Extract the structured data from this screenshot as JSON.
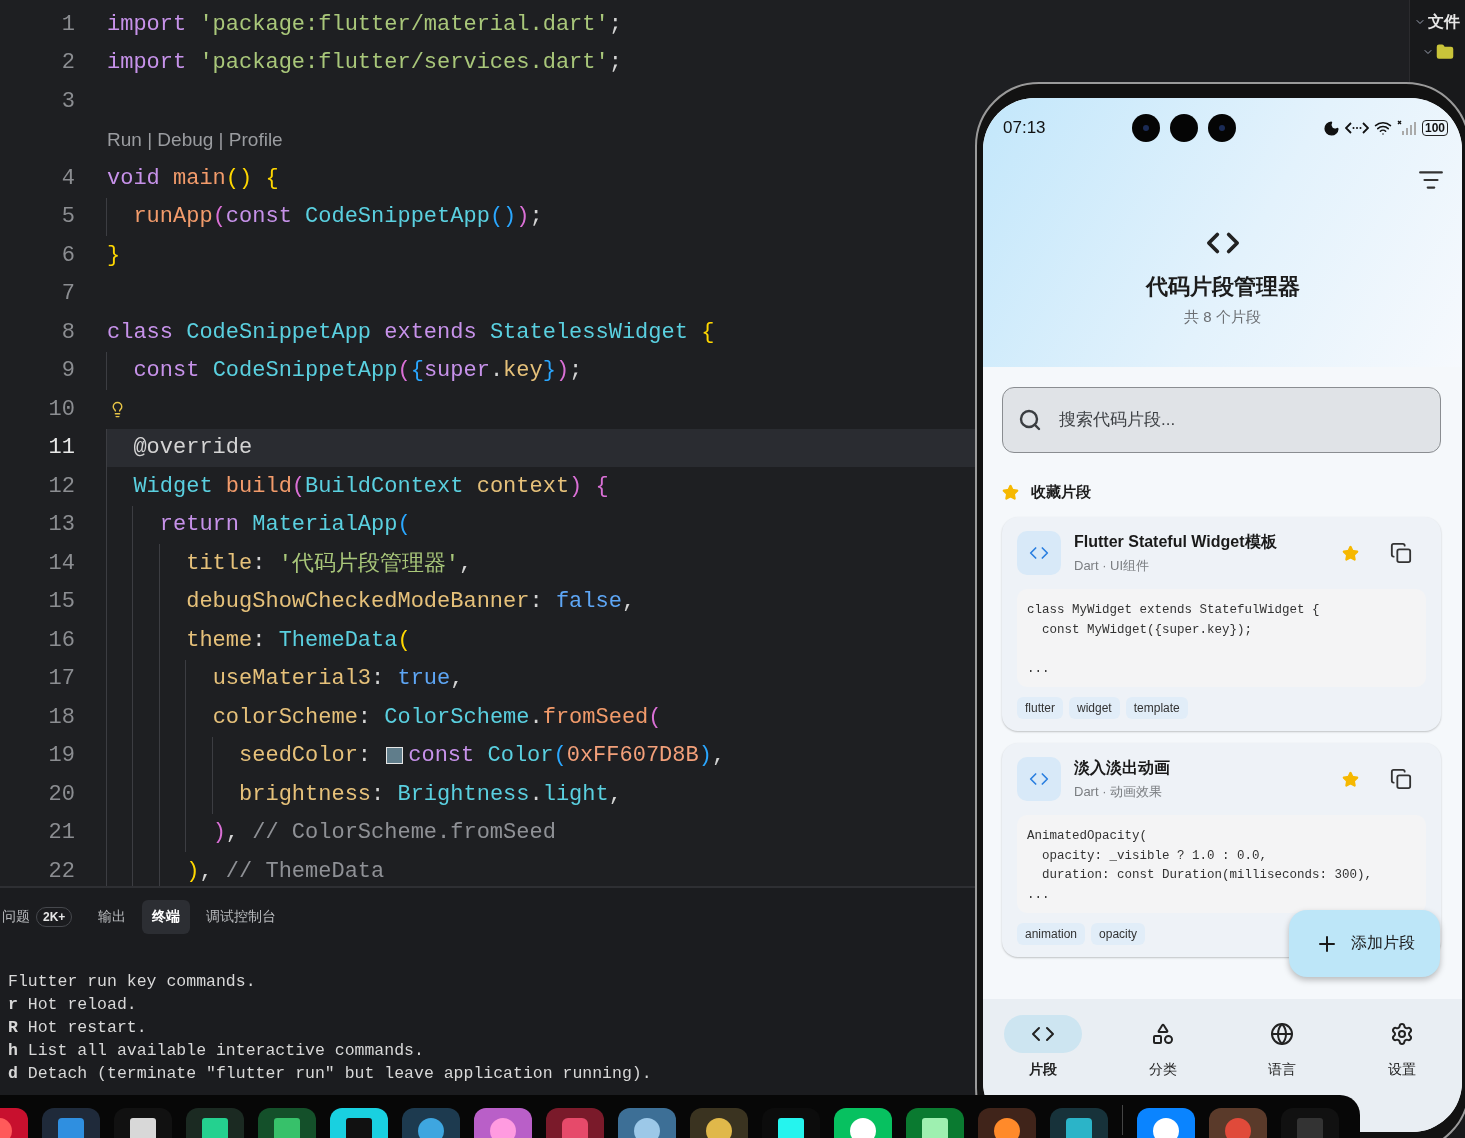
{
  "editor": {
    "lines": [
      {
        "kind": "code",
        "number": "1",
        "current": false,
        "lightbulb": false,
        "tokens": [
          {
            "kind": "kw",
            "text": "import "
          },
          {
            "kind": "str",
            "text": "'package:flutter/material.dart'"
          },
          {
            "kind": "p",
            "text": ";"
          }
        ]
      },
      {
        "kind": "code",
        "number": "2",
        "current": false,
        "lightbulb": false,
        "tokens": [
          {
            "kind": "kw",
            "text": "import "
          },
          {
            "kind": "str",
            "text": "'package:flutter/services.dart'"
          },
          {
            "kind": "p",
            "text": ";"
          }
        ]
      },
      {
        "kind": "code",
        "number": "3",
        "current": false,
        "lightbulb": false
      },
      {
        "kind": "codelens",
        "text": "Run | Debug | Profile"
      },
      {
        "kind": "code",
        "number": "4",
        "current": false,
        "lightbulb": false,
        "tokens": [
          {
            "kind": "kw",
            "text": "void "
          },
          {
            "kind": "fn",
            "text": "main"
          },
          {
            "kind": "b1",
            "text": "() {"
          }
        ]
      },
      {
        "kind": "code",
        "number": "5",
        "current": false,
        "lightbulb": false,
        "tokens": [
          {
            "kind": "fn",
            "text": "  runApp"
          },
          {
            "kind": "b2",
            "text": "("
          },
          {
            "kind": "kw",
            "text": "const "
          },
          {
            "kind": "type",
            "text": "CodeSnippetApp"
          },
          {
            "kind": "b3",
            "text": "()"
          },
          {
            "kind": "b2",
            "text": ")"
          },
          {
            "kind": "p",
            "text": ";"
          }
        ]
      },
      {
        "kind": "code",
        "number": "6",
        "current": false,
        "lightbulb": false,
        "tokens": [
          {
            "kind": "b1",
            "text": "}"
          }
        ]
      },
      {
        "kind": "code",
        "number": "7",
        "current": false,
        "lightbulb": false
      },
      {
        "kind": "code",
        "number": "8",
        "current": false,
        "lightbulb": false,
        "tokens": [
          {
            "kind": "kw",
            "text": "class "
          },
          {
            "kind": "type",
            "text": "CodeSnippetApp "
          },
          {
            "kind": "kw",
            "text": "extends "
          },
          {
            "kind": "type",
            "text": "StatelessWidget "
          },
          {
            "kind": "b1",
            "text": "{"
          }
        ]
      },
      {
        "kind": "code",
        "number": "9",
        "current": false,
        "lightbulb": false,
        "tokens": [
          {
            "kind": "kw",
            "text": "  const "
          },
          {
            "kind": "type",
            "text": "CodeSnippetApp"
          },
          {
            "kind": "b2",
            "text": "("
          },
          {
            "kind": "b3",
            "text": "{"
          },
          {
            "kind": "kw",
            "text": "super"
          },
          {
            "kind": "p",
            "text": "."
          },
          {
            "kind": "prop",
            "text": "key"
          },
          {
            "kind": "b3",
            "text": "}"
          },
          {
            "kind": "b2",
            "text": ")"
          },
          {
            "kind": "p",
            "text": ";"
          }
        ]
      },
      {
        "kind": "code",
        "number": "10",
        "current": false,
        "lightbulb": true
      },
      {
        "kind": "code",
        "number": "11",
        "current": true,
        "lightbulb": false,
        "tokens": [
          {
            "kind": "p",
            "text": "  @override"
          }
        ]
      },
      {
        "kind": "code",
        "number": "12",
        "current": false,
        "lightbulb": false,
        "tokens": [
          {
            "kind": "type",
            "text": "  Widget "
          },
          {
            "kind": "fn",
            "text": "build"
          },
          {
            "kind": "b2",
            "text": "("
          },
          {
            "kind": "type",
            "text": "BuildContext "
          },
          {
            "kind": "prop",
            "text": "context"
          },
          {
            "kind": "b2",
            "text": ") {"
          }
        ]
      },
      {
        "kind": "code",
        "number": "13",
        "current": false,
        "lightbulb": false,
        "tokens": [
          {
            "kind": "kw",
            "text": "    return "
          },
          {
            "kind": "type",
            "text": "MaterialApp"
          },
          {
            "kind": "b3",
            "text": "("
          }
        ]
      },
      {
        "kind": "code",
        "number": "14",
        "current": false,
        "lightbulb": false,
        "tokens": [
          {
            "kind": "prop",
            "text": "      title"
          },
          {
            "kind": "p",
            "text": ": "
          },
          {
            "kind": "str",
            "text": "'代码片段管理器'"
          },
          {
            "kind": "p",
            "text": ","
          }
        ]
      },
      {
        "kind": "code",
        "number": "15",
        "current": false,
        "lightbulb": false,
        "tokens": [
          {
            "kind": "prop",
            "text": "      debugShowCheckedModeBanner"
          },
          {
            "kind": "p",
            "text": ": "
          },
          {
            "kind": "lit",
            "text": "false"
          },
          {
            "kind": "p",
            "text": ","
          }
        ]
      },
      {
        "kind": "code",
        "number": "16",
        "current": false,
        "lightbulb": false,
        "tokens": [
          {
            "kind": "prop",
            "text": "      theme"
          },
          {
            "kind": "p",
            "text": ": "
          },
          {
            "kind": "type",
            "text": "ThemeData"
          },
          {
            "kind": "b1",
            "text": "("
          }
        ]
      },
      {
        "kind": "code",
        "number": "17",
        "current": false,
        "lightbulb": false,
        "tokens": [
          {
            "kind": "prop",
            "text": "        useMaterial3"
          },
          {
            "kind": "p",
            "text": ": "
          },
          {
            "kind": "lit",
            "text": "true"
          },
          {
            "kind": "p",
            "text": ","
          }
        ]
      },
      {
        "kind": "code",
        "number": "18",
        "current": false,
        "lightbulb": false,
        "tokens": [
          {
            "kind": "prop",
            "text": "        colorScheme"
          },
          {
            "kind": "p",
            "text": ": "
          },
          {
            "kind": "type",
            "text": "ColorScheme"
          },
          {
            "kind": "p",
            "text": "."
          },
          {
            "kind": "fn",
            "text": "fromSeed"
          },
          {
            "kind": "b2",
            "text": "("
          }
        ]
      },
      {
        "kind": "code",
        "number": "19",
        "current": false,
        "lightbulb": false,
        "tokens": [
          {
            "kind": "prop",
            "text": "          seedColor"
          },
          {
            "kind": "p",
            "text": ": "
          },
          {
            "kind": "swatch",
            "color": "#607d8b"
          },
          {
            "kind": "kw",
            "text": "const "
          },
          {
            "kind": "type",
            "text": "Color"
          },
          {
            "kind": "b3",
            "text": "("
          },
          {
            "kind": "num",
            "text": "0xFF607D8B"
          },
          {
            "kind": "b3",
            "text": ")"
          },
          {
            "kind": "p",
            "text": ","
          }
        ]
      },
      {
        "kind": "code",
        "number": "20",
        "current": false,
        "lightbulb": false,
        "tokens": [
          {
            "kind": "prop",
            "text": "          brightness"
          },
          {
            "kind": "p",
            "text": ": "
          },
          {
            "kind": "type",
            "text": "Brightness"
          },
          {
            "kind": "p",
            "text": "."
          },
          {
            "kind": "type",
            "text": "light"
          },
          {
            "kind": "p",
            "text": ","
          }
        ]
      },
      {
        "kind": "code",
        "number": "21",
        "current": false,
        "lightbulb": false,
        "tokens": [
          {
            "kind": "b2",
            "text": "        )"
          },
          {
            "kind": "p",
            "text": ", "
          },
          {
            "kind": "com",
            "text": "// ColorScheme.fromSeed"
          }
        ]
      },
      {
        "kind": "code",
        "number": "22",
        "current": false,
        "lightbulb": false,
        "tokens": [
          {
            "kind": "b1",
            "text": "      )"
          },
          {
            "kind": "p",
            "text": ", "
          },
          {
            "kind": "com",
            "text": "// ThemeData"
          }
        ]
      }
    ]
  },
  "panel": {
    "tabs": [
      {
        "label": "问题",
        "badge": "2K+",
        "selected": false
      },
      {
        "label": "输出",
        "selected": false
      },
      {
        "label": "终端",
        "selected": true
      },
      {
        "label": "调试控制台",
        "selected": false
      }
    ],
    "terminal": [
      {
        "text": "Flutter run key commands."
      },
      {
        "key": "r",
        "text": "Hot reload."
      },
      {
        "key": "R",
        "text": "Hot restart."
      },
      {
        "key": "h",
        "text": "List all available interactive commands."
      },
      {
        "key": "d",
        "text": "Detach (terminate \"flutter run\" but leave application running)."
      }
    ]
  },
  "explorer": {
    "title": "文件"
  },
  "phone": {
    "status_bar": {
      "time": "07:13",
      "battery": "100"
    },
    "header": {
      "title": "代码片段管理器",
      "subtitle": "共 8 个片段"
    },
    "search": {
      "placeholder": "搜索代码片段..."
    },
    "section_title": "收藏片段",
    "snippets": [
      {
        "title": "Flutter Stateful Widget模板",
        "meta": "Dart · UI组件",
        "favorite": true,
        "code": "class MyWidget extends StatefulWidget {\n  const MyWidget({super.key});\n\n...",
        "tags": [
          "flutter",
          "widget",
          "template"
        ]
      },
      {
        "title": "淡入淡出动画",
        "meta": "Dart · 动画效果",
        "favorite": true,
        "code": "AnimatedOpacity(\n  opacity: _visible ? 1.0 : 0.0,\n  duration: const Duration(milliseconds: 300),\n...",
        "tags": [
          "animation",
          "opacity"
        ]
      }
    ],
    "fab": {
      "label": "添加片段"
    },
    "nav": [
      {
        "kind": "snippets",
        "label": "片段",
        "selected": true
      },
      {
        "kind": "categories",
        "label": "分类",
        "selected": false
      },
      {
        "kind": "languages",
        "label": "语言",
        "selected": false
      },
      {
        "kind": "settings",
        "label": "设置",
        "selected": false
      }
    ]
  }
}
